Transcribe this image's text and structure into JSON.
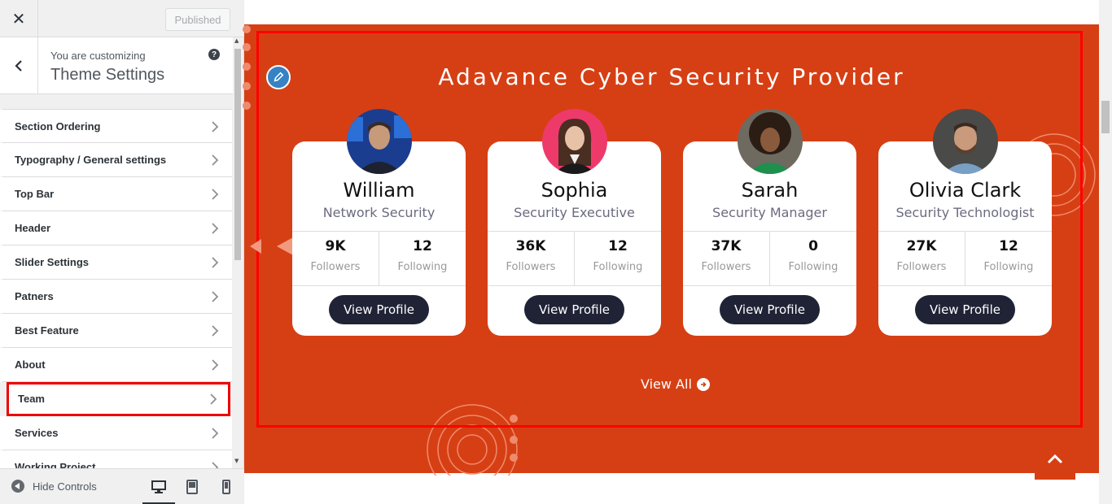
{
  "sidebar": {
    "published_label": "Published",
    "customizing_label": "You are customizing",
    "panel_title": "Theme Settings",
    "items": [
      {
        "label": "Section Ordering"
      },
      {
        "label": "Typography / General settings"
      },
      {
        "label": "Top Bar"
      },
      {
        "label": "Header"
      },
      {
        "label": "Slider Settings"
      },
      {
        "label": "Patners"
      },
      {
        "label": "Best Feature"
      },
      {
        "label": "About"
      },
      {
        "label": "Team"
      },
      {
        "label": "Services"
      },
      {
        "label": "Working Project"
      }
    ],
    "hide_controls_label": "Hide Controls"
  },
  "section": {
    "title": "Adavance Cyber Security Provider",
    "followers_label": "Followers",
    "following_label": "Following",
    "view_profile_label": "View Profile",
    "view_all_label": "View All",
    "members": [
      {
        "name": "William",
        "role": "Network Security",
        "followers": "9K",
        "following": "12"
      },
      {
        "name": "Sophia",
        "role": "Security Executive",
        "followers": "36K",
        "following": "12"
      },
      {
        "name": "Sarah",
        "role": "Security Manager",
        "followers": "37K",
        "following": "0"
      },
      {
        "name": "Olivia Clark",
        "role": "Security Technologist",
        "followers": "27K",
        "following": "12"
      }
    ]
  },
  "colors": {
    "section_background": "#d63f14",
    "button_dark": "#1f2335",
    "highlight_outline": "#ff0000"
  }
}
